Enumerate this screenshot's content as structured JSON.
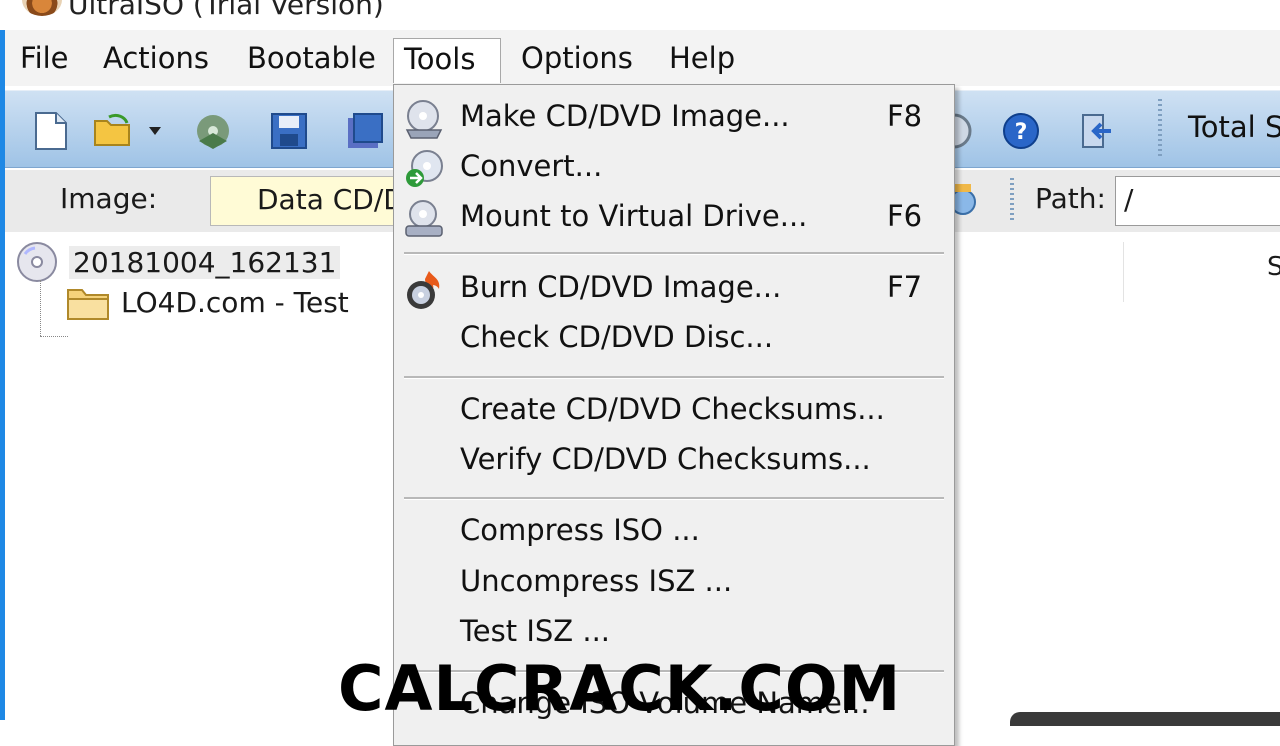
{
  "window": {
    "title": "UltraISO (Trial Version)"
  },
  "menubar": {
    "items": [
      {
        "label": "File"
      },
      {
        "label": "Actions"
      },
      {
        "label": "Bootable"
      },
      {
        "label": "Tools"
      },
      {
        "label": "Options"
      },
      {
        "label": "Help"
      }
    ]
  },
  "toolbar": {
    "icons": [
      "new-file-icon",
      "open-folder-icon",
      "dropdown-arrow-icon",
      "extract-icon",
      "save-icon",
      "save-as-icon",
      "settings-icon",
      "help-icon",
      "exit-icon"
    ],
    "total_label": "Total S"
  },
  "imagebar": {
    "image_label": "Image:",
    "image_value": "Data CD/D",
    "path_label": "Path:",
    "path_value": "/"
  },
  "tree": {
    "root": "20181004_162131",
    "child": "LO4D.com - Test"
  },
  "right_pane": {
    "partial_header": "S"
  },
  "tools_menu": {
    "items": [
      {
        "label": "Make CD/DVD Image...",
        "shortcut": "F8",
        "icon": "make-image-icon"
      },
      {
        "label": "Convert...",
        "shortcut": "",
        "icon": "convert-icon"
      },
      {
        "label": "Mount to Virtual Drive...",
        "shortcut": "F6",
        "icon": "virtual-drive-icon"
      },
      {
        "label": "Burn CD/DVD Image...",
        "shortcut": "F7",
        "icon": "burn-icon"
      },
      {
        "label": "Check CD/DVD Disc...",
        "shortcut": ""
      },
      {
        "label": "Create CD/DVD Checksums...",
        "shortcut": ""
      },
      {
        "label": "Verify CD/DVD Checksums...",
        "shortcut": ""
      },
      {
        "label": "Compress ISO ...",
        "shortcut": ""
      },
      {
        "label": "Uncompress ISZ ...",
        "shortcut": ""
      },
      {
        "label": "Test ISZ ...",
        "shortcut": ""
      },
      {
        "label": "Change ISO Volume Name...",
        "shortcut": ""
      }
    ]
  },
  "watermark": "CALCRACK.COM",
  "colors": {
    "toolbar_top": "#cfe1f3",
    "toolbar_bottom": "#9fc3e6",
    "menu_bg": "#f0f0f0",
    "image_field": "#fffbd6",
    "frame": "#1e88e5"
  }
}
